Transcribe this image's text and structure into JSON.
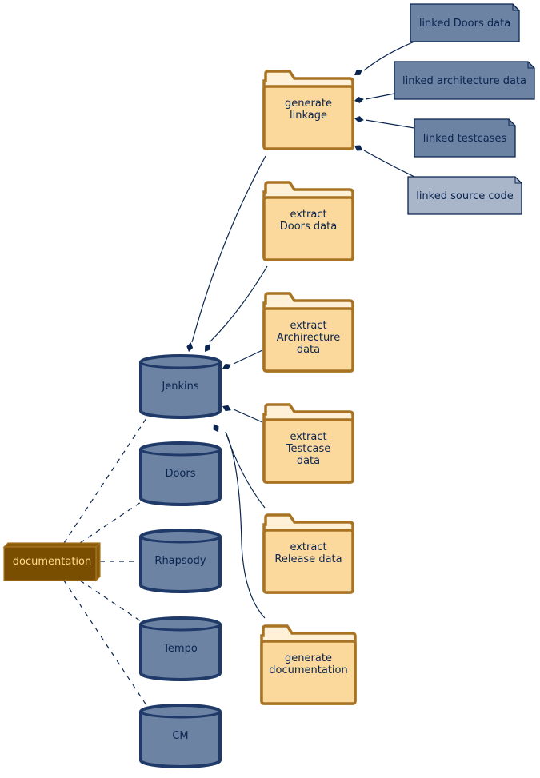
{
  "colors": {
    "folder_fill": "#fbd99c",
    "folder_tab": "#fff0d8",
    "folder_stroke": "#a87424",
    "db_fill": "#6d83a4",
    "db_stroke": "#1f3a68",
    "note_fill": "#6d83a4",
    "note_light": "#a9b5c8",
    "note_stroke": "#0a2550",
    "node_fill": "#7a4e00",
    "node_text": "#ffd98a",
    "edge": "#0a2550"
  },
  "folders": [
    {
      "id": "gen-linkage",
      "lines": [
        "generate",
        "linkage"
      ]
    },
    {
      "id": "extract-doors",
      "lines": [
        "extract",
        "Doors data"
      ]
    },
    {
      "id": "extract-arch",
      "lines": [
        "extract",
        "Archirecture",
        "data"
      ]
    },
    {
      "id": "extract-testcase",
      "lines": [
        "extract",
        "Testcase",
        "data"
      ]
    },
    {
      "id": "extract-release",
      "lines": [
        "extract",
        "Release data"
      ]
    },
    {
      "id": "gen-doc",
      "lines": [
        "generate",
        "documentation"
      ]
    }
  ],
  "databases": [
    {
      "label": "Jenkins"
    },
    {
      "label": "Doors"
    },
    {
      "label": "Rhapsody"
    },
    {
      "label": "Tempo"
    },
    {
      "label": "CM"
    }
  ],
  "notes": [
    {
      "label": "linked Doors data",
      "light": false
    },
    {
      "label": "linked architecture data",
      "light": false
    },
    {
      "label": "linked testcases",
      "light": false
    },
    {
      "label": "linked source code",
      "light": true
    }
  ],
  "node": {
    "label": "documentation"
  }
}
